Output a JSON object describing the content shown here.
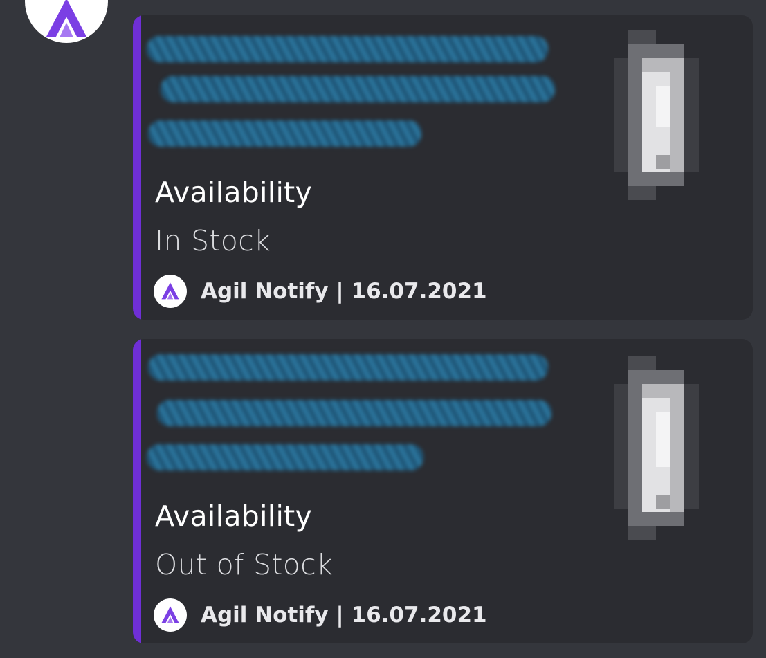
{
  "bot": {
    "avatar_icon": "agil-logo-icon",
    "brand_color": "#6f2fd6"
  },
  "embeds": [
    {
      "accent_color": "#6f2fd6",
      "field_name": "Availability",
      "field_value": "In Stock",
      "footer_icon": "agil-logo-icon",
      "footer_text": "Agil Notify | 16.07.2021"
    },
    {
      "accent_color": "#6f2fd6",
      "field_name": "Availability",
      "field_value": "Out of Stock",
      "footer_icon": "agil-logo-icon",
      "footer_text": "Agil Notify | 16.07.2021"
    }
  ]
}
